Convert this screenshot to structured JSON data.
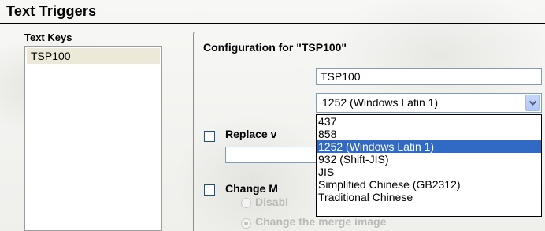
{
  "section": {
    "title": "Text Triggers"
  },
  "text_keys": {
    "label": "Text Keys",
    "items": [
      "TSP100"
    ],
    "selected_index": 0
  },
  "config": {
    "title": "Configuration for \"TSP100\"",
    "name_value": "TSP100",
    "codepage_selected": "1252 (Windows Latin 1)",
    "codepage_options": [
      "437",
      "858",
      "1252 (Windows Latin 1)",
      "932 (Shift-JIS)",
      "JIS",
      "Simplified Chinese (GB2312)",
      "Traditional Chinese"
    ],
    "highlighted_option_index": 2,
    "replace_label": "Replace v",
    "replace_value": "",
    "change_label": "Change M",
    "radio_disable_label": "Disabl",
    "radio_change_label": "Change the merge image"
  },
  "icons": {
    "dropdown_arrow": "chevron-down-icon"
  },
  "colors": {
    "selection": "#316ac5",
    "list_selection": "#ece9d8",
    "input_border": "#7f9db9",
    "checkbox_border": "#1c5180"
  }
}
